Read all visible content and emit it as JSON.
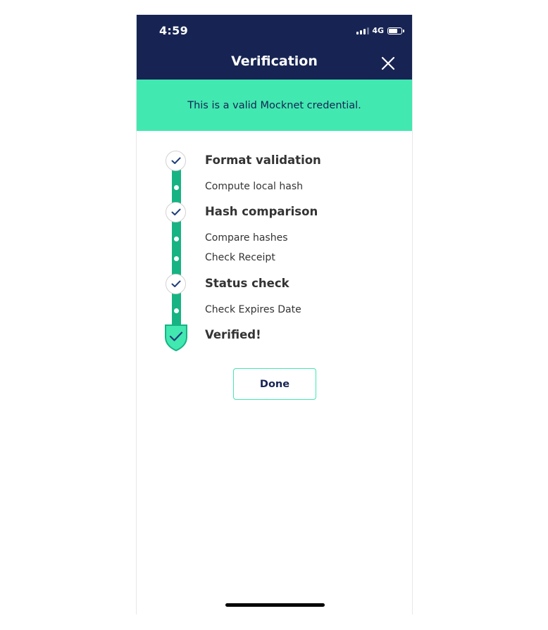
{
  "status_bar": {
    "time": "4:59",
    "network": "4G",
    "battery_level": 0.72
  },
  "header": {
    "title": "Verification"
  },
  "banner": {
    "message": "This is a valid Mocknet credential."
  },
  "steps": [
    {
      "label": "Format validation"
    },
    {
      "label": "Compute local hash"
    },
    {
      "label": "Hash comparison"
    },
    {
      "label": "Compare hashes"
    },
    {
      "label": "Check Receipt"
    },
    {
      "label": "Status check"
    },
    {
      "label": "Check Expires Date"
    },
    {
      "label": "Verified!"
    }
  ],
  "actions": {
    "done_label": "Done"
  },
  "colors": {
    "header_bg": "#172453",
    "banner_bg": "#41e8b0",
    "rail": "#17b383",
    "check": "#1f3f7a",
    "shield_fill": "#41e8b0"
  }
}
